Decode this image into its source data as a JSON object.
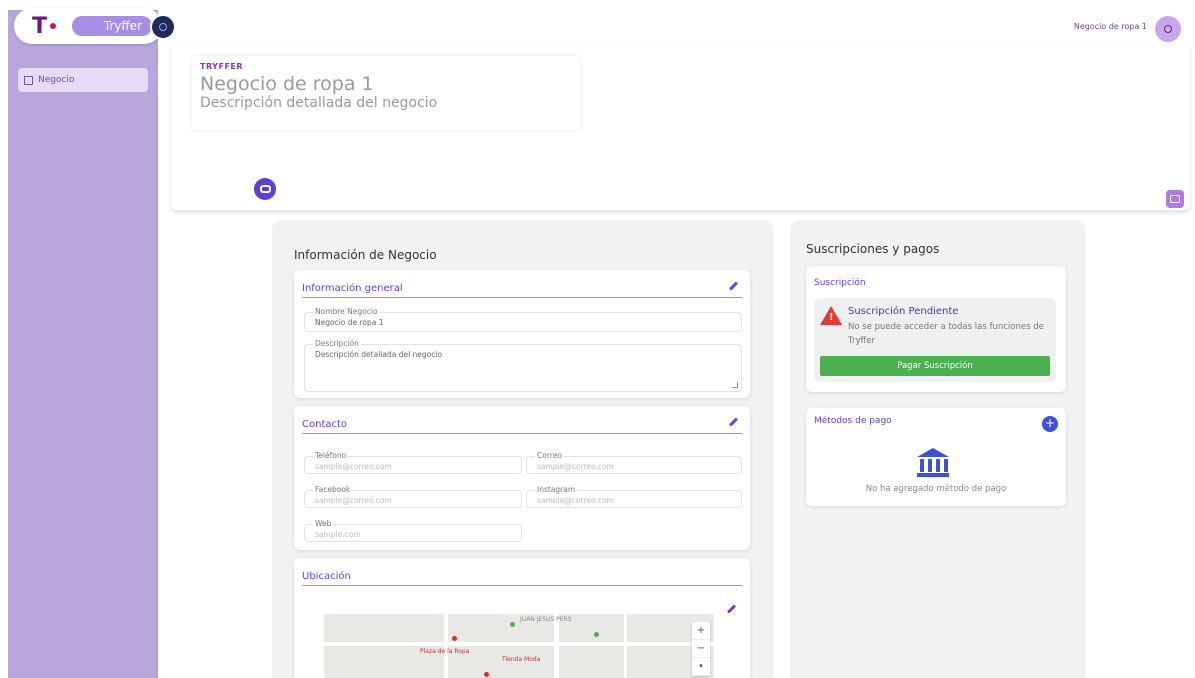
{
  "app": {
    "logo_letter": "T",
    "brand_name": "Tryffer"
  },
  "sidebar": {
    "items": [
      {
        "label": "Negocio",
        "icon": "calendar-icon",
        "active": true
      }
    ]
  },
  "topbar": {
    "business_name": "Negocio de ropa 1",
    "avatar_icon": "user-icon"
  },
  "banner": {
    "tag": "TRYFFER",
    "title": "Negocio de ropa 1",
    "description": "Descripción detallada del negocio"
  },
  "business_info": {
    "title": "Información de Negocio",
    "general": {
      "heading": "Información general",
      "name_label": "Nombre Negocio",
      "name_value": "Negocio de ropa 1",
      "description_label": "Descripción",
      "description_value": "Descripción detallada del negocio"
    },
    "contact": {
      "heading": "Contacto",
      "phone_label": "Teléfono",
      "phone_placeholder": "sample@correo.com",
      "email_label": "Correo",
      "email_placeholder": "sample@correo.com",
      "facebook_label": "Facebook",
      "facebook_placeholder": "sample@correo.com",
      "instagram_label": "Instagram",
      "instagram_placeholder": "sample@correo.com",
      "web_label": "Web",
      "web_placeholder": "sample.com"
    },
    "location": {
      "heading": "Ubicación",
      "street_label": "JUAN JESUS PERS",
      "poi_1": "Plaza de la Ropa",
      "poi_2": "Tienda Moda"
    }
  },
  "subscriptions": {
    "title": "Suscripciones y pagos",
    "subscription": {
      "heading": "Suscripción",
      "status_title": "Suscripción Pendiente",
      "status_message": "No se puede acceder a todas las funciones de Tryffer",
      "pay_button": "Pagar Suscripción"
    },
    "payment_methods": {
      "heading": "Métodos de pago",
      "add_label": "+",
      "empty_message": "No ha agregado método de pago"
    }
  },
  "colors": {
    "sidebar": "#b6a6dc",
    "accent": "#6a3fc8",
    "pay_button": "#4caf50",
    "warning": "#e53935"
  }
}
